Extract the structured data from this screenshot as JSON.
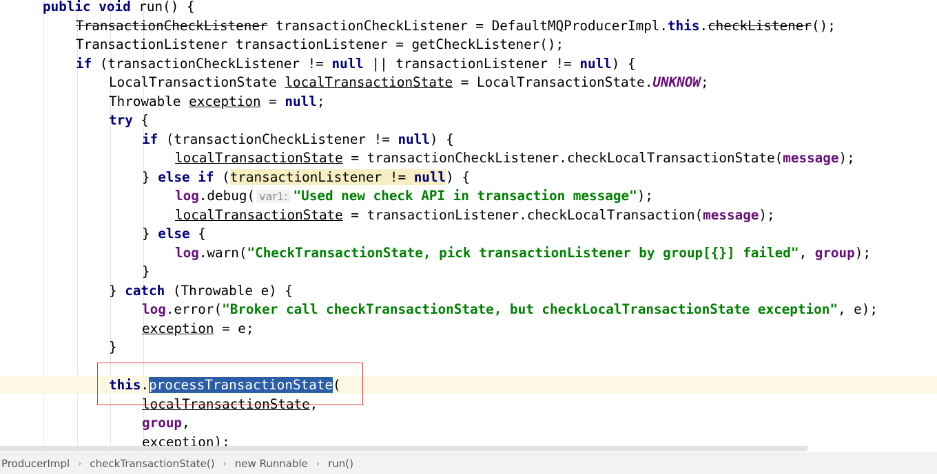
{
  "editor": {
    "lines": [
      {
        "indent": 1,
        "tokens": [
          {
            "t": "public void",
            "c": "kw"
          },
          {
            "t": " run() {"
          }
        ]
      },
      {
        "indent": 2,
        "tokens": [
          {
            "t": "TransactionCheckListener",
            "c": "dep"
          },
          {
            "t": " transactionCheckListener = DefaultMQProducerImpl."
          },
          {
            "t": "this",
            "c": "kw"
          },
          {
            "t": "."
          },
          {
            "t": "checkListener",
            "c": "dep"
          },
          {
            "t": "();"
          }
        ]
      },
      {
        "indent": 2,
        "tokens": [
          {
            "t": "TransactionListener transactionListener = getCheckListener();"
          }
        ]
      },
      {
        "indent": 2,
        "tokens": [
          {
            "t": "if",
            "c": "kw"
          },
          {
            "t": " (transactionCheckListener != "
          },
          {
            "t": "null",
            "c": "kw"
          },
          {
            "t": " || transactionListener != "
          },
          {
            "t": "null",
            "c": "kw"
          },
          {
            "t": ") {"
          }
        ]
      },
      {
        "indent": 3,
        "tokens": [
          {
            "t": "LocalTransactionState "
          },
          {
            "t": "localTransactionState",
            "c": "ul"
          },
          {
            "t": " = LocalTransactionState."
          },
          {
            "t": "UNKNOW",
            "c": "sfld"
          },
          {
            "t": ";"
          }
        ]
      },
      {
        "indent": 3,
        "tokens": [
          {
            "t": "Throwable "
          },
          {
            "t": "exception",
            "c": "ul"
          },
          {
            "t": " = "
          },
          {
            "t": "null",
            "c": "kw"
          },
          {
            "t": ";"
          }
        ]
      },
      {
        "indent": 3,
        "tokens": [
          {
            "t": "try",
            "c": "kw"
          },
          {
            "t": " {"
          }
        ]
      },
      {
        "indent": 4,
        "tokens": [
          {
            "t": "if",
            "c": "kw"
          },
          {
            "t": " (transactionCheckListener != "
          },
          {
            "t": "null",
            "c": "kw"
          },
          {
            "t": ") {"
          }
        ]
      },
      {
        "indent": 5,
        "tokens": [
          {
            "t": "localTransactionState",
            "c": "ul"
          },
          {
            "t": " = transactionCheckListener.checkLocalTransactionState("
          },
          {
            "t": "message",
            "c": "fld"
          },
          {
            "t": ");"
          }
        ]
      },
      {
        "indent": 4,
        "tokens": [
          {
            "t": "} "
          },
          {
            "t": "else if",
            "c": "kw"
          },
          {
            "t": " ("
          },
          {
            "t": "transactionListener != ",
            "c": "hl"
          },
          {
            "t": "null",
            "c": "kw hl"
          },
          {
            "t": ") {"
          }
        ]
      },
      {
        "indent": 5,
        "tokens": [
          {
            "t": "log",
            "c": "fld"
          },
          {
            "t": ".debug("
          },
          {
            "t": "var1:",
            "c": "hint"
          },
          {
            "t": "\"Used new check API in transaction message\"",
            "c": "str"
          },
          {
            "t": ");"
          }
        ]
      },
      {
        "indent": 5,
        "tokens": [
          {
            "t": "localTransactionState",
            "c": "ul"
          },
          {
            "t": " = transactionListener.checkLocalTransaction("
          },
          {
            "t": "message",
            "c": "fld"
          },
          {
            "t": ");"
          }
        ]
      },
      {
        "indent": 4,
        "tokens": [
          {
            "t": "} "
          },
          {
            "t": "else",
            "c": "kw"
          },
          {
            "t": " {"
          }
        ]
      },
      {
        "indent": 5,
        "tokens": [
          {
            "t": "log",
            "c": "fld"
          },
          {
            "t": ".warn("
          },
          {
            "t": "\"CheckTransactionState, pick transactionListener by group[{}] failed\"",
            "c": "str"
          },
          {
            "t": ", "
          },
          {
            "t": "group",
            "c": "fld"
          },
          {
            "t": ");"
          }
        ]
      },
      {
        "indent": 4,
        "tokens": [
          {
            "t": "}"
          }
        ]
      },
      {
        "indent": 3,
        "tokens": [
          {
            "t": "} "
          },
          {
            "t": "catch",
            "c": "kw"
          },
          {
            "t": " (Throwable e) {"
          }
        ]
      },
      {
        "indent": 4,
        "tokens": [
          {
            "t": "log",
            "c": "fld"
          },
          {
            "t": ".error("
          },
          {
            "t": "\"Broker call checkTransactionState, but checkLocalTransactionState exception\"",
            "c": "str"
          },
          {
            "t": ", e);"
          }
        ]
      },
      {
        "indent": 4,
        "tokens": [
          {
            "t": "exception",
            "c": "ul"
          },
          {
            "t": " = e;"
          }
        ]
      },
      {
        "indent": 3,
        "tokens": [
          {
            "t": "}"
          }
        ]
      },
      {
        "indent": 0,
        "tokens": []
      },
      {
        "indent": 3,
        "current": true,
        "tokens": [
          {
            "t": "this",
            "c": "kw"
          },
          {
            "t": "."
          },
          {
            "t": "processTransactionState",
            "c": "sel"
          },
          {
            "t": "("
          }
        ]
      },
      {
        "indent": 4,
        "tokens": [
          {
            "t": "localTransactionState",
            "c": "ul"
          },
          {
            "t": ","
          }
        ]
      },
      {
        "indent": 4,
        "tokens": [
          {
            "t": "group",
            "c": "fld"
          },
          {
            "t": ","
          }
        ]
      },
      {
        "indent": 4,
        "tokens": [
          {
            "t": "exception",
            "c": "ul"
          },
          {
            "t": ");"
          }
        ]
      }
    ]
  },
  "breadcrumb": {
    "items": [
      "ProducerImpl",
      "checkTransactionState()",
      "new Runnable",
      "run()"
    ],
    "separator": "›"
  },
  "colors": {
    "keyword": "#000080",
    "string": "#008000",
    "field": "#660e7a",
    "selection": "#2b5ea6",
    "current_line": "#fcf8e3",
    "annotation_box": "#e03a3a"
  }
}
